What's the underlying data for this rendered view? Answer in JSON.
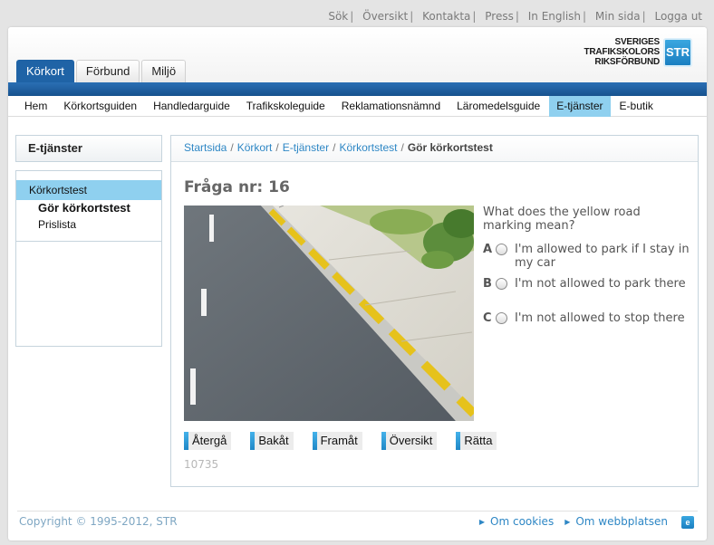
{
  "top_links": [
    {
      "label": "Sök",
      "name": "top-link-sok"
    },
    {
      "label": "Översikt",
      "name": "top-link-oversikt"
    },
    {
      "label": "Kontakta",
      "name": "top-link-kontakta"
    },
    {
      "label": "Press",
      "name": "top-link-press"
    },
    {
      "label": "In English",
      "name": "top-link-in-english"
    },
    {
      "label": "Min sida",
      "name": "top-link-min-sida"
    },
    {
      "label": "Logga ut",
      "name": "top-link-logga-ut"
    }
  ],
  "logo": {
    "line1": "SVERIGES",
    "line2": "TRAFIKSKOLORS",
    "line3": "RIKSFÖRBUND",
    "mark": "STR"
  },
  "tabs": [
    "Körkort",
    "Förbund",
    "Miljö"
  ],
  "main_nav": [
    "Hem",
    "Körkortsguiden",
    "Handledarguide",
    "Trafikskoleguide",
    "Reklamationsnämnd",
    "Läromedelsguide",
    "E-tjänster",
    "E-butik"
  ],
  "sidebar": {
    "header": "E-tjänster",
    "item": "Körkortstest",
    "sub_items": [
      "Gör körkortstest",
      "Prislista"
    ]
  },
  "breadcrumb": [
    "Startsida",
    "Körkort",
    "E-tjänster",
    "Körkortstest"
  ],
  "breadcrumb_current": "Gör körkortstest",
  "question": {
    "title": "Fråga nr: 16",
    "text": "What does the yellow road marking mean?",
    "options": [
      {
        "letter": "A",
        "text": "I'm allowed to park if I stay in my car"
      },
      {
        "letter": "B",
        "text": "I'm not allowed to park there"
      },
      {
        "letter": "C",
        "text": "I'm not allowed to stop there"
      }
    ]
  },
  "buttons": [
    "Återgå",
    "Bakåt",
    "Framåt",
    "Översikt",
    "Rätta"
  ],
  "code": "10735",
  "footer": {
    "copyright": "Copyright © 1995-2012, STR",
    "links": [
      "Om cookies",
      "Om webbplatsen"
    ]
  },
  "colors": {
    "brand_blue": "#1f63a6",
    "active_nav": "#8fd0ef",
    "link": "#2e87c5"
  }
}
